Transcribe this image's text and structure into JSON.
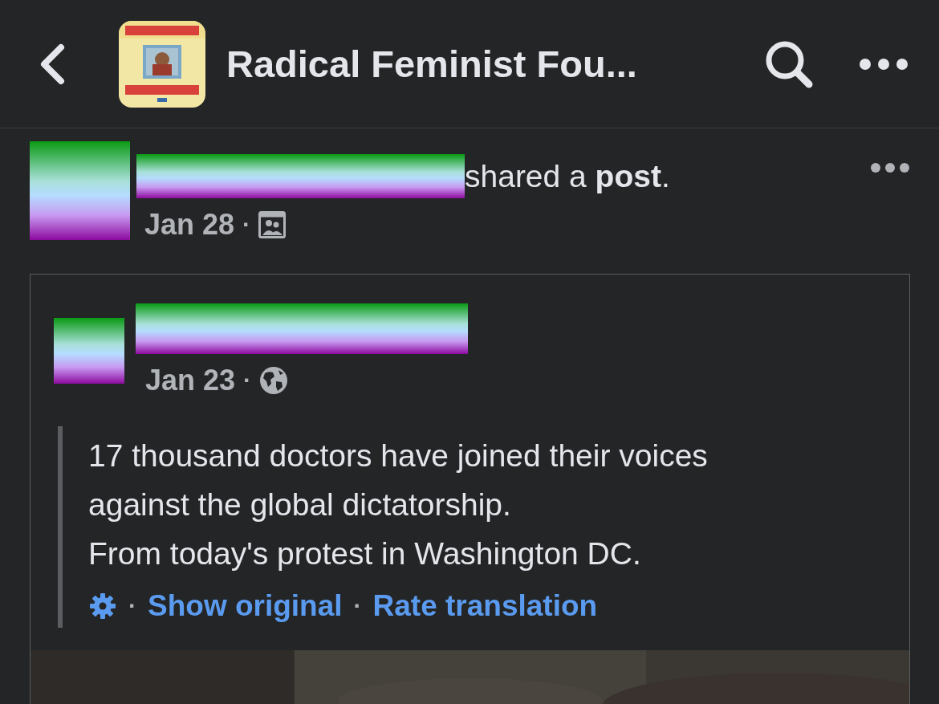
{
  "header": {
    "title": "Radical Feminist Fou..."
  },
  "post": {
    "action": "shared a **post**.",
    "date": "Jan 28",
    "separator": "·",
    "audience": {
      "kind": "group"
    }
  },
  "shared_post": {
    "date": "Jan 23",
    "separator": "·",
    "audience": {
      "kind": "public"
    },
    "text": "17 thousand doctors have joined their voices\nagainst the global dictatorship.\nFrom today's protest in Washington DC.",
    "translation": {
      "separator_1": "·",
      "show_original": "Show original",
      "separator_2": "·",
      "rate": "Rate translation"
    }
  }
}
